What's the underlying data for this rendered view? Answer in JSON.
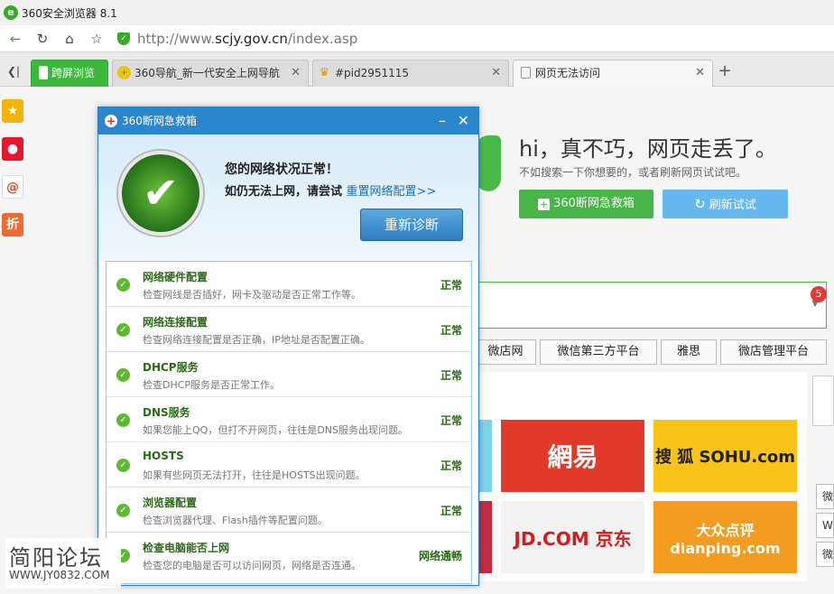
{
  "window": {
    "title": "360安全浏览器 8.1"
  },
  "addressbar": {
    "url_prefix": "http://www.",
    "url_domain": "scjy.gov.cn",
    "url_path": "/index.asp"
  },
  "tabs": [
    {
      "label": "跨屏浏览"
    },
    {
      "label": "360导航_新一代安全上网导航"
    },
    {
      "label": "#pid2951115"
    },
    {
      "label": "网页无法访问"
    }
  ],
  "error_page": {
    "heading": "hi，真不巧，网页走丢了。",
    "subtext": "不如搜索一下你想要的，或者刷新网页试试吧。",
    "rescue_button": "360断网急救箱",
    "refresh_button": "刷新试试",
    "badge_count": "5",
    "nav_links": [
      "微店网",
      "微信第三方平台",
      "雅思",
      "微店管理平台"
    ],
    "tiles": [
      {
        "label": "網易",
        "color": "#e13a2b"
      },
      {
        "label": "搜 狐 SOHU.com",
        "color": "#f7c417"
      },
      {
        "label": "JD.COM 京东",
        "color": "#f2f2f2"
      },
      {
        "label": "大众点评 dianping.com",
        "color": "#f39c1f"
      }
    ],
    "right_edge_labels": [
      "微",
      "W",
      "微"
    ]
  },
  "dialog": {
    "title": "360断网急救箱",
    "status_line": "您的网络状况正常！",
    "hint_line": "如仍无法上网，请尝试",
    "hint_link": "重置网络配置>>",
    "rediagnose_button": "重新诊断",
    "checks": [
      {
        "title": "网络硬件配置",
        "desc": "检查网线是否插好，网卡及驱动是否正常工作等。",
        "status": "正常"
      },
      {
        "title": "网络连接配置",
        "desc": "检查网络连接配置是否正确，IP地址是否配置正确。",
        "status": "正常"
      },
      {
        "title": "DHCP服务",
        "desc": "检查DHCP服务是否正常工作。",
        "status": "正常"
      },
      {
        "title": "DNS服务",
        "desc": "如果您能上QQ，但打不开网页，往往是DNS服务出现问题。",
        "status": "正常"
      },
      {
        "title": "HOSTS",
        "desc": "如果有些网页无法打开，往往是HOSTS出现问题。",
        "status": "正常"
      },
      {
        "title": "浏览器配置",
        "desc": "检查浏览器代理、Flash插件等配置问题。",
        "status": "正常"
      },
      {
        "title": "检查电脑能否上网",
        "desc": "检查您的电脑是否可以访问网页，网络是否连通。",
        "status": "网络通畅"
      }
    ]
  },
  "watermark": {
    "line1": "简阳论坛",
    "line2": "WWW.JY0832.COM"
  },
  "colors": {
    "accent_green": "#3aa92a",
    "dialog_blue": "#2c86cc",
    "ok_green": "#2b6a16"
  }
}
